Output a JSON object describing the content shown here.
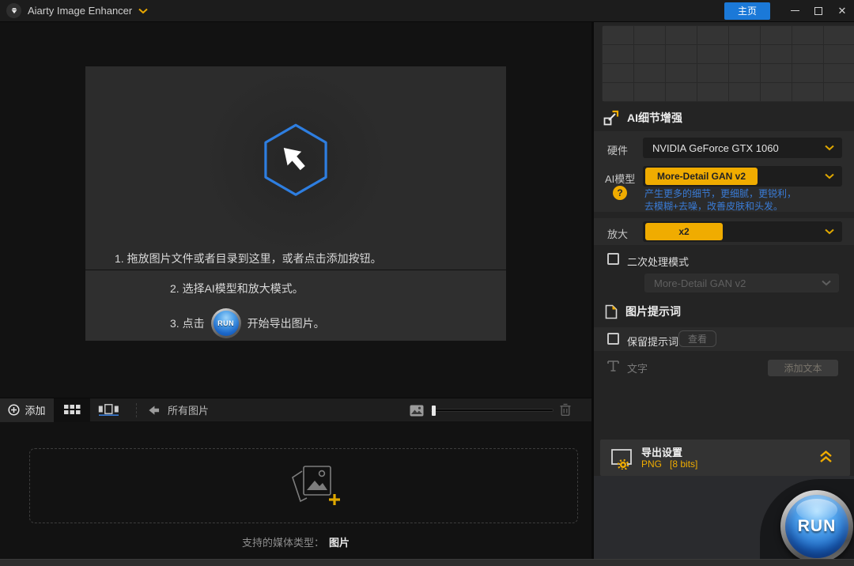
{
  "colors": {
    "accent_yellow": "#f0ac00",
    "home_button_blue": "#1b79d8",
    "hexagon_blue": "#2e7ee0",
    "description_blue": "#3a7bd5",
    "run_button_blue": "#2071d0"
  },
  "icons": {
    "help_glyph": "?",
    "plus_glyph": "+"
  },
  "titlebar": {
    "app_name": "Aiarty Image Enhancer",
    "home_label": "主页"
  },
  "dropzone": {
    "step1": "1. 拖放图片文件或者目录到这里，或者点击添加按钮。",
    "step2": "2. 选择AI模型和放大模式。",
    "step3_prefix": "3. 点击",
    "step3_run_label": "RUN",
    "step3_suffix": "开始导出图片。"
  },
  "toolbar": {
    "add_label": "添加",
    "all_images_label": "所有图片"
  },
  "import_area": {
    "supported_label": "支持的媒体类型：",
    "supported_value": "图片"
  },
  "side_panel": {
    "ai_section_title": "AI细节增强",
    "hardware_label": "硬件",
    "hardware_value": "NVIDIA GeForce GTX 1060",
    "model_label": "AI模型",
    "model_value": "More-Detail GAN v2",
    "model_desc_line1": "产生更多的细节，更细腻，更锐利，",
    "model_desc_line2": "去模糊+去噪，改善皮肤和头发。",
    "scale_label": "放大",
    "scale_value": "x2",
    "secondary_mode_label": "二次处理模式",
    "secondary_model_value": "More-Detail GAN v2",
    "prompt_section_title": "图片提示词",
    "keep_prompt_label": "保留提示词",
    "view_button_label": "查看",
    "text_label": "文字",
    "add_text_button_label": "添加文本",
    "export_title": "导出设置",
    "export_format": "PNG",
    "export_bits": "[8 bits]",
    "run_button_label": "RUN"
  }
}
